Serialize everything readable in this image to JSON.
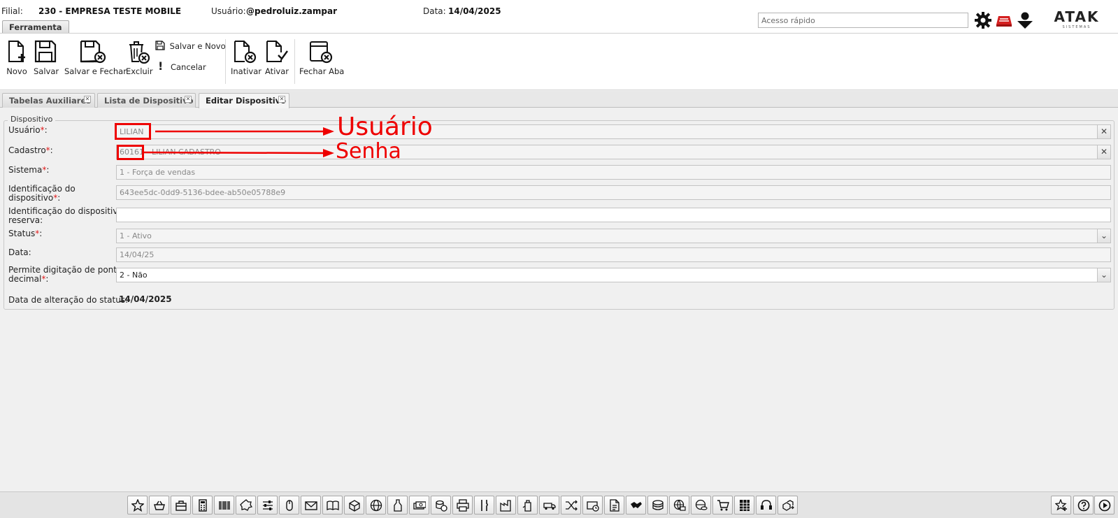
{
  "header": {
    "filial_label": "Filial:",
    "filial_value": "230 - EMPRESA TESTE MOBILE",
    "usuario_label": "Usuário:",
    "usuario_value": "@pedroluiz.zampar",
    "data_label": "Data:",
    "data_value": "14/04/2025",
    "quick_access_placeholder": "Acesso rápido",
    "logo_text": "ATAK",
    "logo_sub": "SISTEMAS",
    "tool_tab": "Ferramenta"
  },
  "ribbon": {
    "novo": "Novo",
    "salvar": "Salvar",
    "salvar_fechar": "Salvar e Fechar",
    "excluir": "Excluir",
    "salvar_novo": "Salvar e Novo",
    "cancelar": "Cancelar",
    "inativar": "Inativar",
    "ativar": "Ativar",
    "fechar_aba": "Fechar Aba"
  },
  "tabs": [
    {
      "label": "Tabelas Auxiliares"
    },
    {
      "label": "Lista de Dispositivo"
    },
    {
      "label": "Editar Dispositivo"
    }
  ],
  "form": {
    "legend": "Dispositivo",
    "usuario_label": "Usuário",
    "usuario_value": "LILIAN",
    "cadastro_label": "Cadastro",
    "cadastro_value": "60161 - LILIAN CADASTRO",
    "sistema_label": "Sistema",
    "sistema_value": "1 - Força de vendas",
    "ident_label_1": "Identificação do",
    "ident_label_2": "dispositivo",
    "ident_value": "643ee5dc-0dd9-5136-bdee-ab50e05788e9",
    "ident_reserva_label_1": "Identificação do dispositivo",
    "ident_reserva_label_2": "reserva:",
    "ident_reserva_value": "",
    "status_label": "Status",
    "status_value": "1 - Ativo",
    "data_label": "Data:",
    "data_value": "14/04/25",
    "permite_label_1": "Permite digitação de ponto",
    "permite_label_2": "decimal",
    "permite_value": "2 - Não",
    "data_alteracao_label": "Data de alteração do status:",
    "data_alteracao_value": "14/04/2025",
    "required_mark": "*",
    "colon": ":"
  },
  "annotations": {
    "usuario": "Usuário",
    "senha": "Senha"
  },
  "colors": {
    "annotation": "#ee0000",
    "required": "#e01a1a"
  }
}
